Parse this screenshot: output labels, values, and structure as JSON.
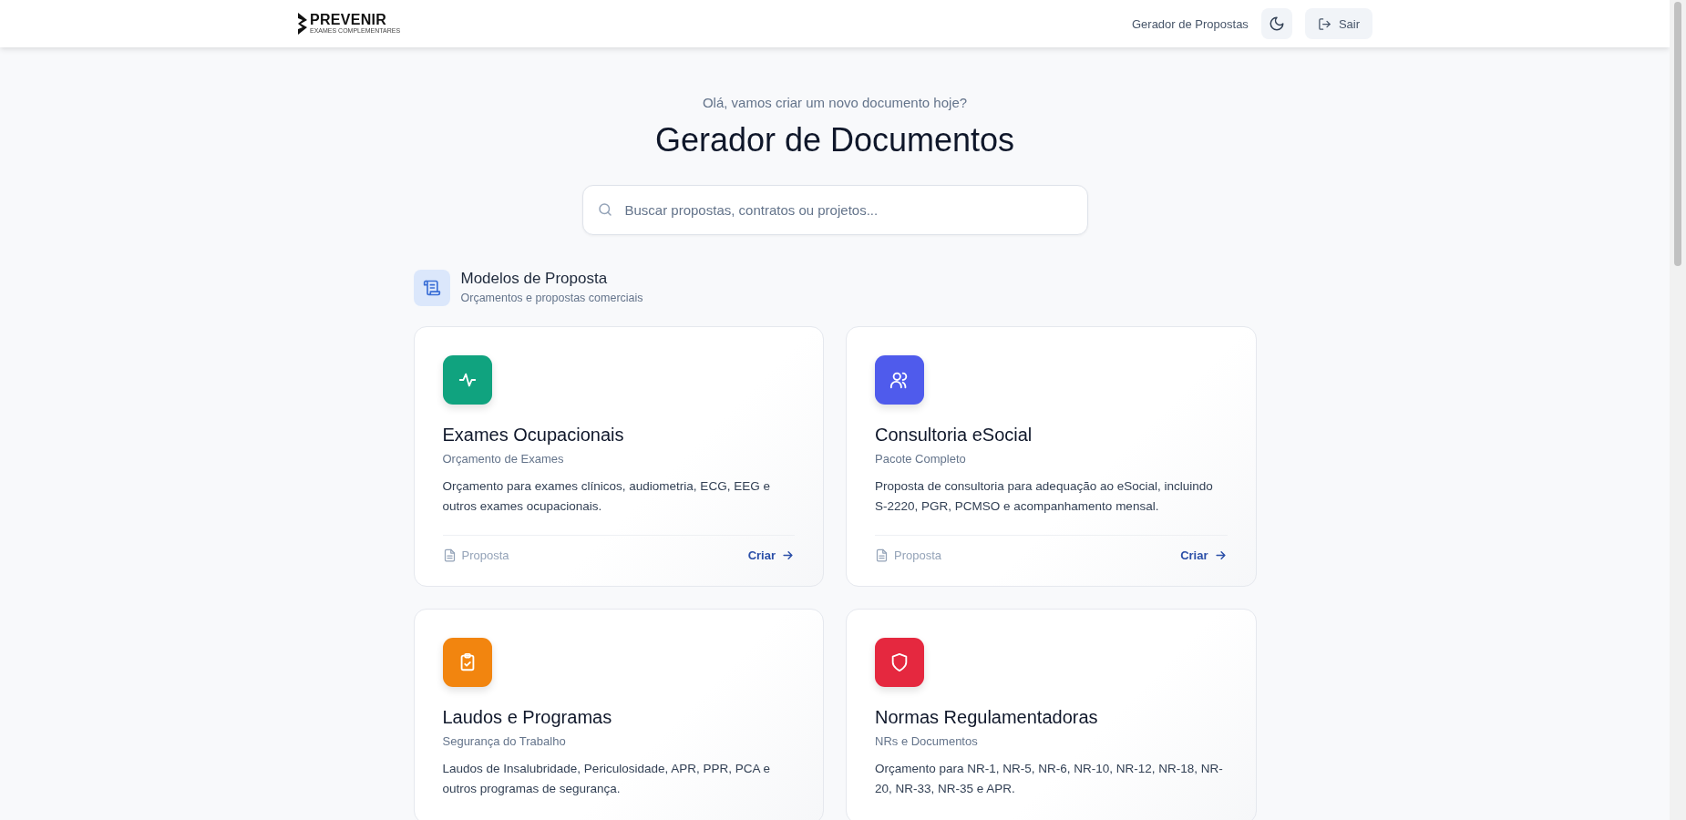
{
  "header": {
    "logo": {
      "name": "PREVENIR",
      "tagline": "EXAMES COMPLEMENTARES"
    },
    "nav_link": "Gerador de Propostas",
    "logout": "Sair"
  },
  "greeting": "Olá, vamos criar um novo documento hoje?",
  "title": "Gerador de Documentos",
  "search": {
    "placeholder": "Buscar propostas, contratos ou projetos..."
  },
  "section": {
    "title": "Modelos de Proposta",
    "subtitle": "Orçamentos e propostas comerciais"
  },
  "cards": [
    {
      "kind": "pulse",
      "color": "#10a37f",
      "title": "Exames Ocupacionais",
      "subtitle": "Orçamento de Exames",
      "description": "Orçamento para exames clínicos, audiometria, ECG, EEG e outros exames ocupacionais.",
      "tag": "Proposta",
      "action": "Criar"
    },
    {
      "kind": "users",
      "color": "#4f5bec",
      "title": "Consultoria eSocial",
      "subtitle": "Pacote Completo",
      "description": "Proposta de consultoria para adequação ao eSocial, incluindo S-2220, PGR, PCMSO e acompanhamento mensal.",
      "tag": "Proposta",
      "action": "Criar"
    },
    {
      "kind": "clipboard",
      "color": "#f2850f",
      "title": "Laudos e Programas",
      "subtitle": "Segurança do Trabalho",
      "description": "Laudos de Insalubridade, Periculosidade, APR, PPR, PCA e outros programas de segurança."
    },
    {
      "kind": "shield",
      "color": "#e5283f",
      "title": "Normas Regulamentadoras",
      "subtitle": "NRs e Documentos",
      "description": "Orçamento para NR-1, NR-5, NR-6, NR-10, NR-12, NR-18, NR-20, NR-33, NR-35 e APR."
    }
  ]
}
